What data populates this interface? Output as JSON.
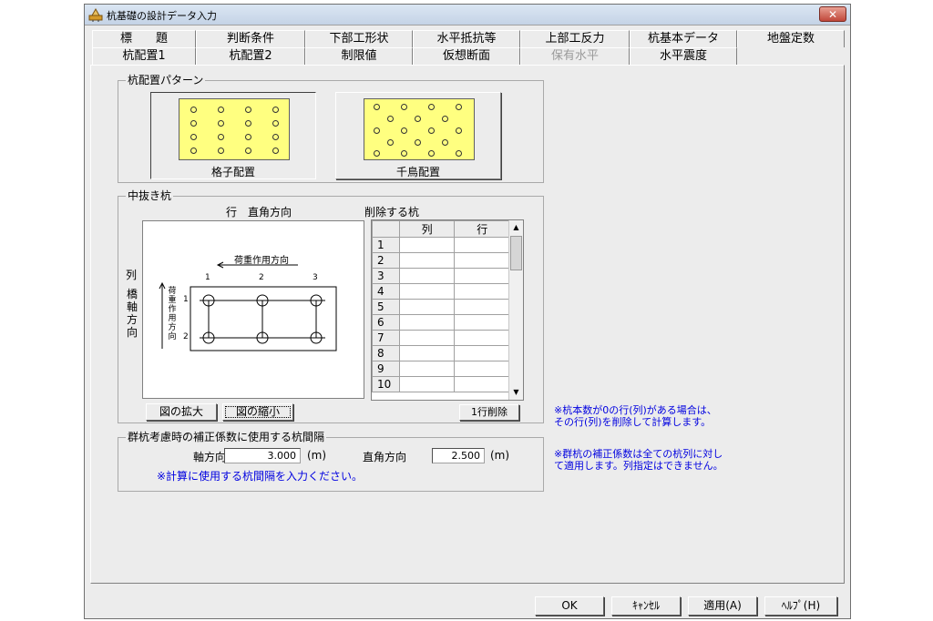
{
  "window": {
    "title": "杭基礎の設計データ入力",
    "close_glyph": "✕"
  },
  "tabs_row1": [
    "標　　題",
    "判断条件",
    "下部工形状",
    "水平抵抗等",
    "上部工反力",
    "杭基本データ",
    "地盤定数"
  ],
  "tabs_row2": [
    {
      "label": "杭配置1",
      "active": true,
      "disabled": false
    },
    {
      "label": "杭配置2",
      "active": false,
      "disabled": false
    },
    {
      "label": "制限値",
      "active": false,
      "disabled": false
    },
    {
      "label": "仮想断面",
      "active": false,
      "disabled": false
    },
    {
      "label": "保有水平",
      "active": false,
      "disabled": true
    },
    {
      "label": "水平震度",
      "active": false,
      "disabled": false
    }
  ],
  "pattern_group": {
    "label": "杭配置パターン",
    "grid_button": "格子配置",
    "staggered_button": "千鳥配置",
    "color": "#ffff80"
  },
  "hollow_group": {
    "label": "中抜き杭",
    "row_direction": "行　直角方向",
    "col_label": "列",
    "col_direction": "橋軸方向",
    "load_direction": "荷重作用方向",
    "load_direction_vertical": "荷重作用方向",
    "col_numbers": [
      "1",
      "2",
      "3"
    ],
    "row_numbers": [
      "1",
      "2"
    ],
    "zoom_in": "図の拡大",
    "zoom_out": "図の縮小",
    "delete_table": {
      "caption": "削除する杭",
      "headers": [
        "列",
        "行"
      ],
      "rows": [
        "1",
        "2",
        "3",
        "4",
        "5",
        "6",
        "7",
        "8",
        "9",
        "10"
      ]
    },
    "delete_row_button": "1行削除"
  },
  "spacing_group": {
    "label": "群杭考慮時の補正係数に使用する杭間隔",
    "axial_label": "軸方向",
    "axial_value": "3.000",
    "perp_label": "直角方向",
    "perp_value": "2.500",
    "unit": "(m)",
    "note": "※計算に使用する杭間隔を入力ください。"
  },
  "notes": {
    "note1_line1": "※杭本数が0の行(列)がある場合は、",
    "note1_line2": "その行(列)を削除して計算します。",
    "note2_line1": "※群杭の補正係数は全ての杭列に対し",
    "note2_line2": "て適用します。列指定はできません。",
    "color": "#0000e0"
  },
  "footer": {
    "ok": "OK",
    "cancel": "ｷｬﾝｾﾙ",
    "apply": "適用(A)",
    "help": "ﾍﾙﾌﾟ(H)"
  }
}
